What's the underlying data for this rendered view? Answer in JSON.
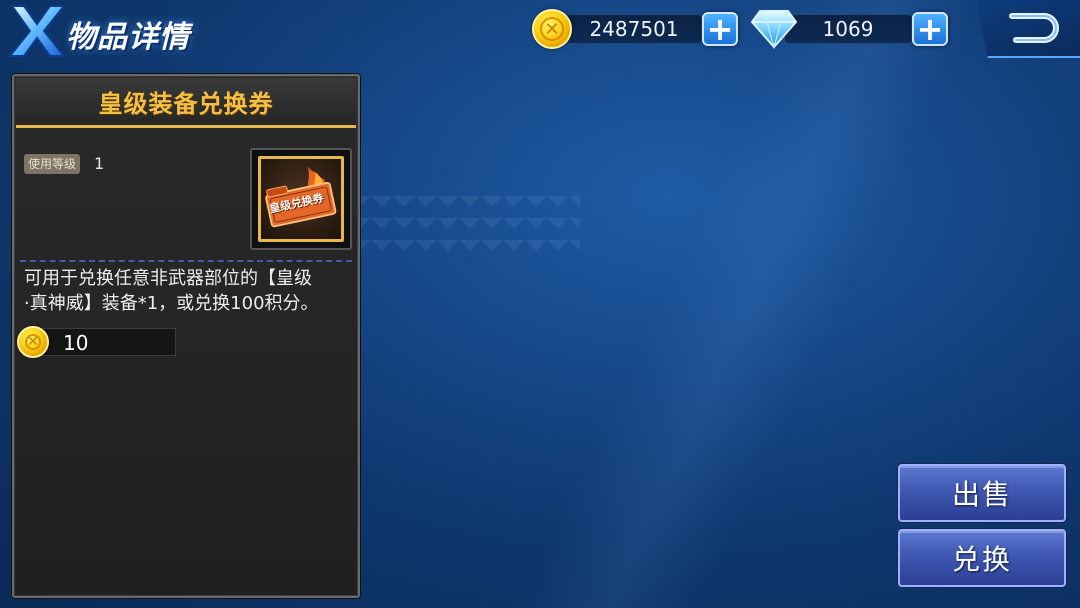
{
  "header": {
    "title": "物品详情",
    "title_icon": "x-emblem-icon"
  },
  "currency": {
    "gold": {
      "icon": "gold-coin-icon",
      "value": "2487501"
    },
    "diamond": {
      "icon": "diamond-icon",
      "value": "1069"
    },
    "plus_label": "+"
  },
  "return_icon": "return-arrow-icon",
  "item": {
    "name": "皇级装备兑换券",
    "level_label": "使用等级",
    "level_value": "1",
    "icon_art_text": "皇级兑换券",
    "description_line1": "可用于兑换任意非武器部位的【皇级",
    "description_line2": "·真神威】装备*1，或兑换100积分。",
    "price_icon": "gold-coin-icon",
    "price": "10"
  },
  "actions": {
    "sell_label": "出售",
    "exchange_label": "兑换"
  },
  "colors": {
    "item_name": "#f6c044",
    "header_underline": "#e5b850",
    "action_button": "#4560bb",
    "plus_button": "#2f8ff0"
  }
}
